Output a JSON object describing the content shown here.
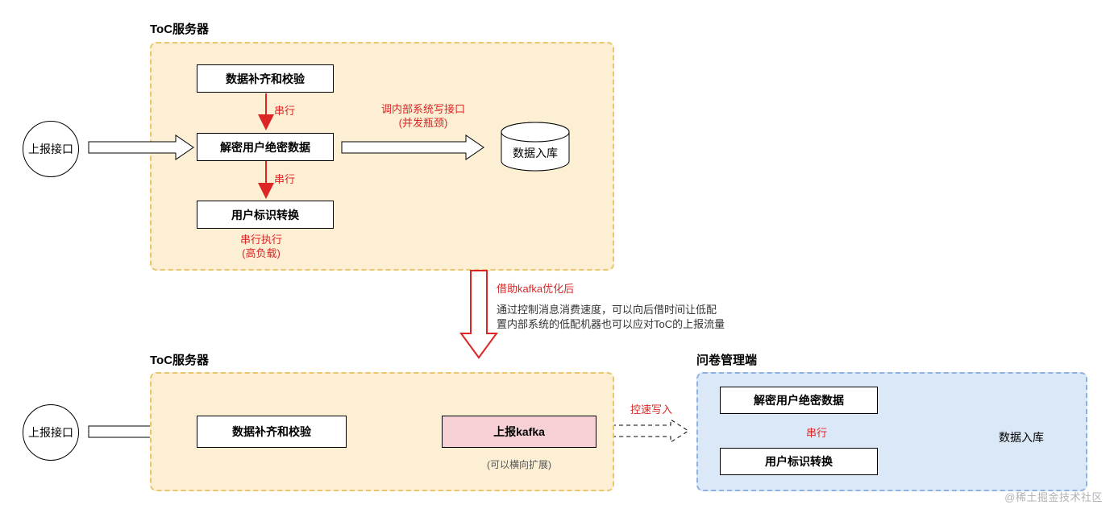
{
  "top": {
    "title": "ToC服务器",
    "circle": "上报接口",
    "step1": "数据补齐和校验",
    "step2": "解密用户绝密数据",
    "step3": "用户标识转换",
    "serial1": "串行",
    "serial2": "串行",
    "note_serial": "串行执行\n(高负载)",
    "note_api": "调内部系统写接口\n(并发瓶颈)",
    "db": "数据入库"
  },
  "middle": {
    "title": "借助kafka优化后",
    "desc": "通过控制消息消费速度，可以向后借时间让低配\n置内部系统的低配机器也可以应对ToC的上报流量"
  },
  "bottom": {
    "title_left": "ToC服务器",
    "title_right": "问卷管理端",
    "circle": "上报接口",
    "step1": "数据补齐和校验",
    "kafka": "上报kafka",
    "kafka_note": "(可以横向扩展)",
    "throttle": "控速写入",
    "decrypt": "解密用户绝密数据",
    "convert": "用户标识转换",
    "serial": "串行",
    "db": "数据入库"
  },
  "watermark": "@稀土掘金技术社区"
}
